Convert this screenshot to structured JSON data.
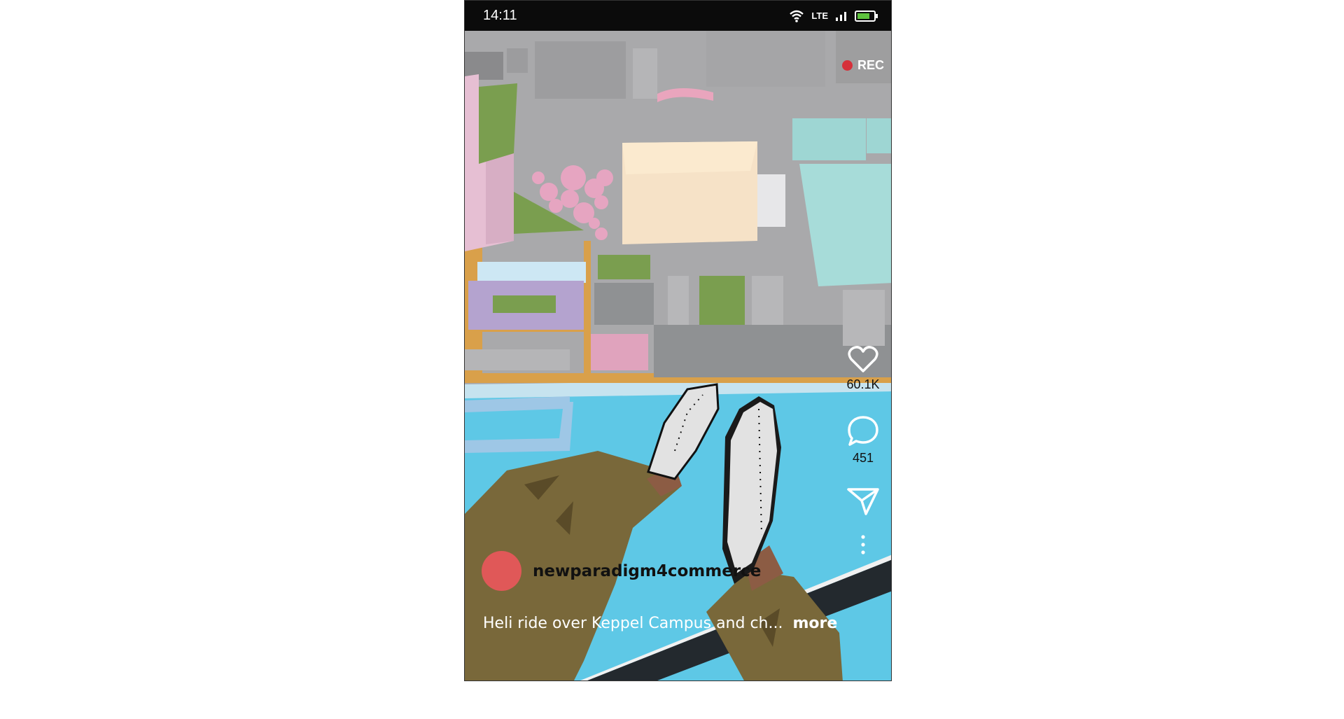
{
  "status_bar": {
    "time": "14:11",
    "network": "LTE",
    "icons": [
      "wifi-icon",
      "signal-icon",
      "battery-icon"
    ]
  },
  "video": {
    "recording_label": "REC",
    "recording_color": "#d6303a"
  },
  "actions": {
    "likes": "60.1K",
    "comments": "451",
    "icons": [
      "heart-icon",
      "comment-icon",
      "send-icon",
      "more-options-icon"
    ]
  },
  "post": {
    "username": "newparadigm4commerce",
    "avatar_color": "#e05858",
    "caption": "Heli ride over Keppel Campus and ch...",
    "more_label": "more"
  }
}
